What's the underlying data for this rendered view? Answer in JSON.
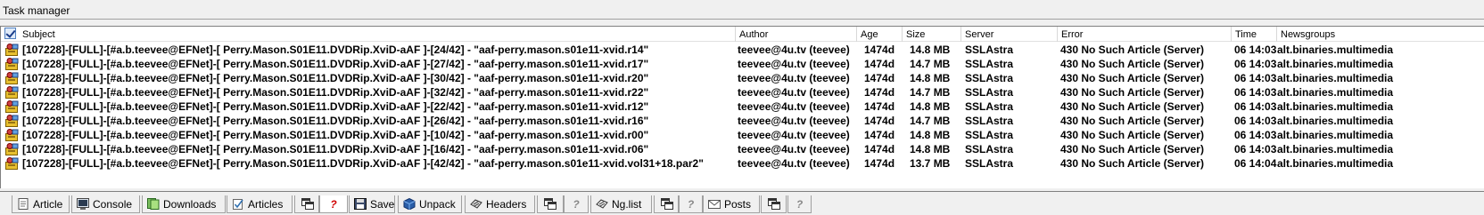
{
  "window": {
    "title": "Task manager"
  },
  "columns": {
    "subject": "Subject",
    "author": "Author",
    "age": "Age",
    "size": "Size",
    "server": "Server",
    "error": "Error",
    "time": "Time",
    "newsgroups": "Newsgroups"
  },
  "rows": [
    {
      "subject": "[107228]-[FULL]-[#a.b.teevee@EFNet]-[ Perry.Mason.S01E11.DVDRip.XviD-aAF ]-[24/42] - \"aaf-perry.mason.s01e11-xvid.r14\"",
      "author": "teevee@4u.tv (teevee)",
      "age": "1474d",
      "size": "14.8 MB",
      "server": "SSLAstra",
      "error": "430 No Such Article (Server)",
      "time": "06 14:03",
      "newsgroups": "alt.binaries.multimedia"
    },
    {
      "subject": "[107228]-[FULL]-[#a.b.teevee@EFNet]-[ Perry.Mason.S01E11.DVDRip.XviD-aAF ]-[27/42] - \"aaf-perry.mason.s01e11-xvid.r17\"",
      "author": "teevee@4u.tv (teevee)",
      "age": "1474d",
      "size": "14.7 MB",
      "server": "SSLAstra",
      "error": "430 No Such Article (Server)",
      "time": "06 14:03",
      "newsgroups": "alt.binaries.multimedia"
    },
    {
      "subject": "[107228]-[FULL]-[#a.b.teevee@EFNet]-[ Perry.Mason.S01E11.DVDRip.XviD-aAF ]-[30/42] - \"aaf-perry.mason.s01e11-xvid.r20\"",
      "author": "teevee@4u.tv (teevee)",
      "age": "1474d",
      "size": "14.8 MB",
      "server": "SSLAstra",
      "error": "430 No Such Article (Server)",
      "time": "06 14:03",
      "newsgroups": "alt.binaries.multimedia"
    },
    {
      "subject": "[107228]-[FULL]-[#a.b.teevee@EFNet]-[ Perry.Mason.S01E11.DVDRip.XviD-aAF ]-[32/42] - \"aaf-perry.mason.s01e11-xvid.r22\"",
      "author": "teevee@4u.tv (teevee)",
      "age": "1474d",
      "size": "14.7 MB",
      "server": "SSLAstra",
      "error": "430 No Such Article (Server)",
      "time": "06 14:03",
      "newsgroups": "alt.binaries.multimedia"
    },
    {
      "subject": "[107228]-[FULL]-[#a.b.teevee@EFNet]-[ Perry.Mason.S01E11.DVDRip.XviD-aAF ]-[22/42] - \"aaf-perry.mason.s01e11-xvid.r12\"",
      "author": "teevee@4u.tv (teevee)",
      "age": "1474d",
      "size": "14.8 MB",
      "server": "SSLAstra",
      "error": "430 No Such Article (Server)",
      "time": "06 14:03",
      "newsgroups": "alt.binaries.multimedia"
    },
    {
      "subject": "[107228]-[FULL]-[#a.b.teevee@EFNet]-[ Perry.Mason.S01E11.DVDRip.XviD-aAF ]-[26/42] - \"aaf-perry.mason.s01e11-xvid.r16\"",
      "author": "teevee@4u.tv (teevee)",
      "age": "1474d",
      "size": "14.7 MB",
      "server": "SSLAstra",
      "error": "430 No Such Article (Server)",
      "time": "06 14:03",
      "newsgroups": "alt.binaries.multimedia"
    },
    {
      "subject": "[107228]-[FULL]-[#a.b.teevee@EFNet]-[ Perry.Mason.S01E11.DVDRip.XviD-aAF ]-[10/42] - \"aaf-perry.mason.s01e11-xvid.r00\"",
      "author": "teevee@4u.tv (teevee)",
      "age": "1474d",
      "size": "14.8 MB",
      "server": "SSLAstra",
      "error": "430 No Such Article (Server)",
      "time": "06 14:03",
      "newsgroups": "alt.binaries.multimedia"
    },
    {
      "subject": "[107228]-[FULL]-[#a.b.teevee@EFNet]-[ Perry.Mason.S01E11.DVDRip.XviD-aAF ]-[16/42] - \"aaf-perry.mason.s01e11-xvid.r06\"",
      "author": "teevee@4u.tv (teevee)",
      "age": "1474d",
      "size": "14.8 MB",
      "server": "SSLAstra",
      "error": "430 No Such Article (Server)",
      "time": "06 14:03",
      "newsgroups": "alt.binaries.multimedia"
    },
    {
      "subject": "[107228]-[FULL]-[#a.b.teevee@EFNet]-[ Perry.Mason.S01E11.DVDRip.XviD-aAF ]-[42/42] - \"aaf-perry.mason.s01e11-xvid.vol31+18.par2\"",
      "author": "teevee@4u.tv (teevee)",
      "age": "1474d",
      "size": "13.7 MB",
      "server": "SSLAstra",
      "error": "430 No Such Article (Server)",
      "time": "06 14:04",
      "newsgroups": "alt.binaries.multimedia"
    }
  ],
  "tabs": [
    {
      "label": "Article",
      "icon": "article-page-icon"
    },
    {
      "label": "Console",
      "icon": "console-icon"
    },
    {
      "label": "Downloads",
      "icon": "downloads-icon"
    },
    {
      "label": "Articles",
      "icon": "articles-icon"
    },
    {
      "label": "",
      "icon": "window-icon"
    },
    {
      "label": "?",
      "icon": "help-icon",
      "active": true
    },
    {
      "label": "Save",
      "icon": "floppy-disk-icon"
    },
    {
      "label": "Unpack",
      "icon": "box-icon"
    },
    {
      "label": "Headers",
      "icon": "headers-icon"
    },
    {
      "label": "",
      "icon": "window-icon"
    },
    {
      "label": "?",
      "icon": "help-icon"
    },
    {
      "label": "Ng.list",
      "icon": "ng-list-icon"
    },
    {
      "label": "",
      "icon": "window-icon"
    },
    {
      "label": "?",
      "icon": "help-icon"
    },
    {
      "label": "Posts",
      "icon": "envelope-icon"
    },
    {
      "label": "",
      "icon": "window-icon"
    },
    {
      "label": "?",
      "icon": "help-icon"
    }
  ]
}
